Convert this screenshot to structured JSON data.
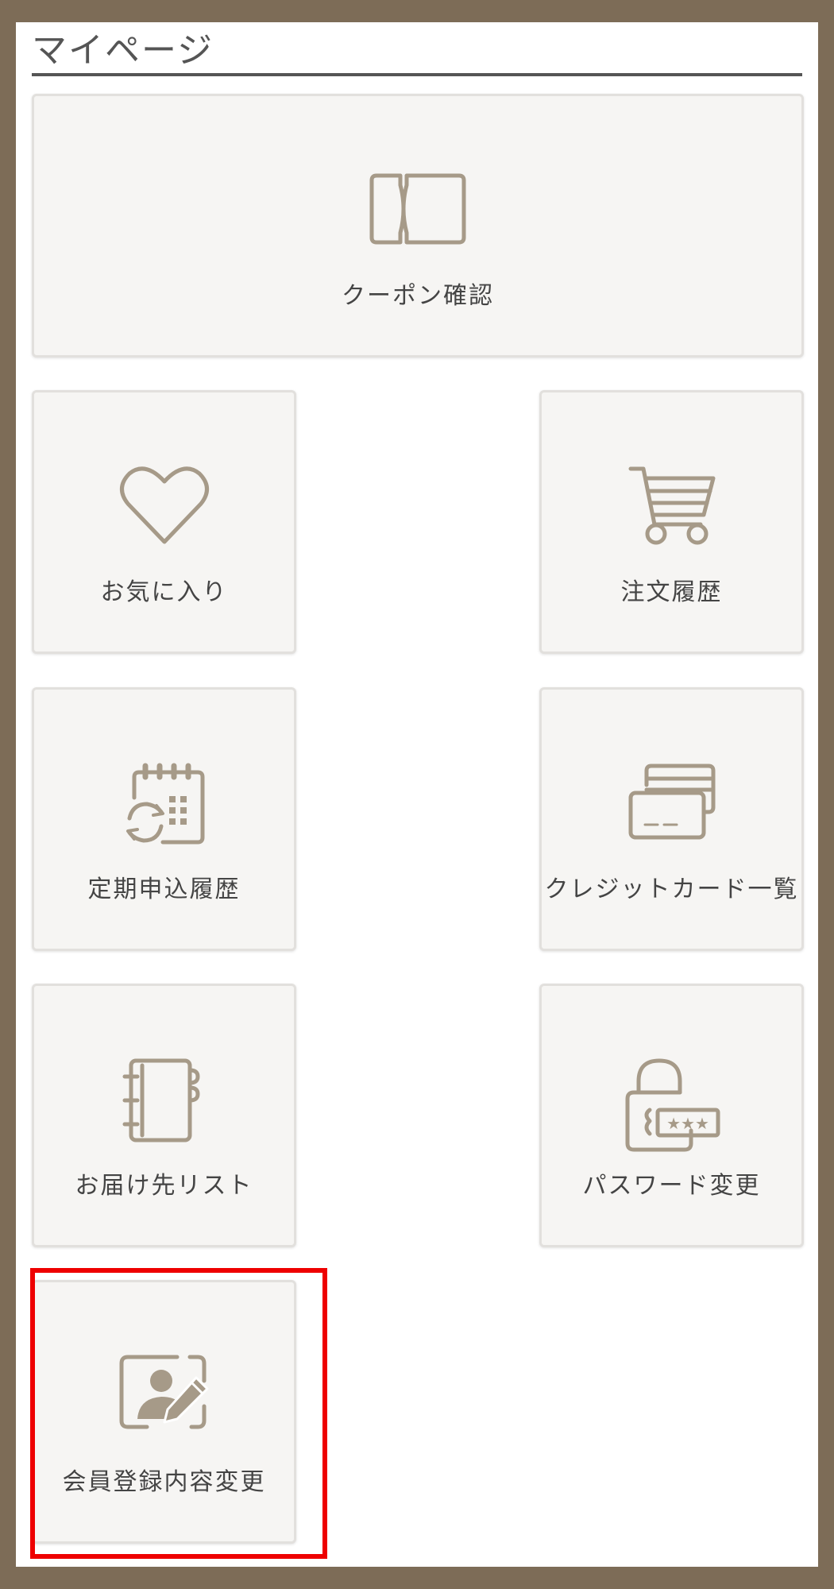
{
  "header": {
    "title": "マイページ"
  },
  "menu": {
    "items": [
      {
        "label": "クーポン確認",
        "icon": "coupon-icon"
      },
      {
        "label": "お気に入り",
        "icon": "heart-icon"
      },
      {
        "label": "注文履歴",
        "icon": "cart-icon"
      },
      {
        "label": "定期申込履歴",
        "icon": "calendar-refresh-icon"
      },
      {
        "label": "クレジットカード一覧",
        "icon": "credit-cards-icon"
      },
      {
        "label": "お届け先リスト",
        "icon": "address-book-icon"
      },
      {
        "label": "パスワード変更",
        "icon": "lock-password-icon"
      },
      {
        "label": "会員登録内容変更",
        "icon": "profile-edit-icon"
      }
    ],
    "highlighted_index": 7
  },
  "colors": {
    "frame": "#7d6c57",
    "tile_background": "#f6f5f3",
    "icon": "#a69a88",
    "text": "#444444",
    "highlight": "#ee0000"
  }
}
